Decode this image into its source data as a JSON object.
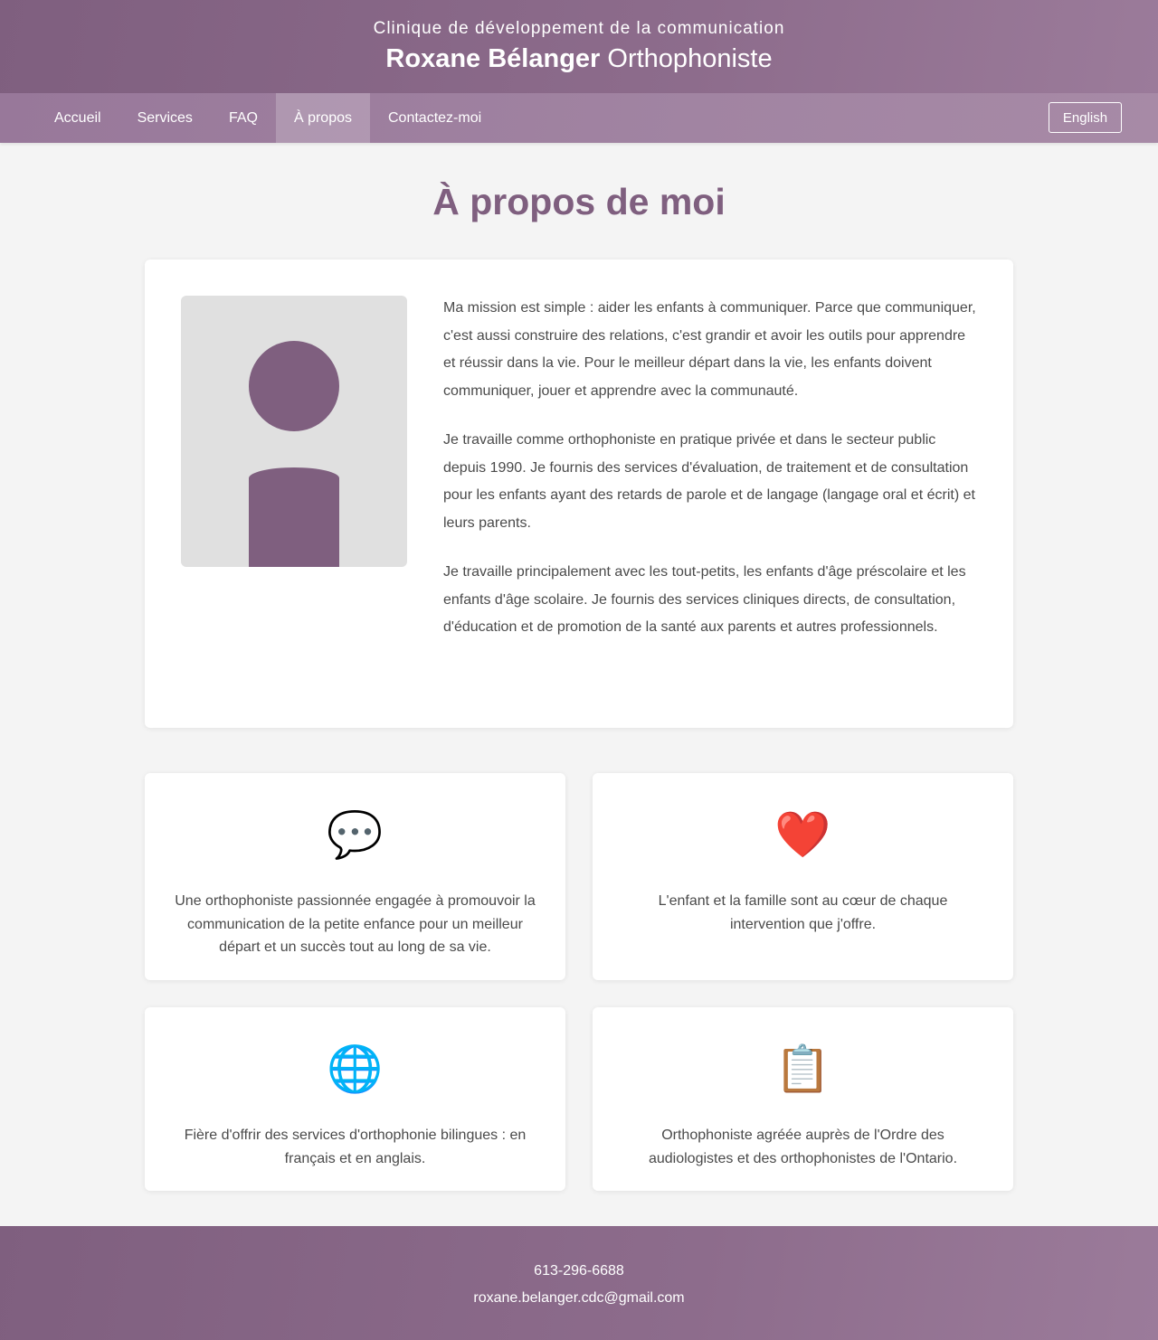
{
  "header": {
    "clinic_name": "Clinique de développement de la communication",
    "name": "Roxane Bélanger",
    "role": "Orthophoniste"
  },
  "nav": {
    "items": [
      {
        "label": "Accueil"
      },
      {
        "label": "Services"
      },
      {
        "label": "FAQ"
      },
      {
        "label": "À propos",
        "active": true
      },
      {
        "label": "Contactez-moi"
      }
    ],
    "language_button": "English"
  },
  "main": {
    "title": "À propos de moi",
    "about_paragraphs": [
      "Ma mission est simple : aider les enfants à communiquer. Parce que communiquer, c'est aussi construire des relations, c'est grandir et avoir les outils pour apprendre et réussir dans la vie. Pour le meilleur départ dans la vie, les enfants doivent communiquer, jouer et apprendre avec la communauté.",
      "Je travaille comme orthophoniste en pratique privée et dans le secteur public depuis 1990. Je fournis des services d'évaluation, de traitement et de consultation pour les enfants ayant des retards de parole et de langage (langage oral et écrit) et leurs parents.",
      "Je travaille principalement avec les tout-petits, les enfants d'âge préscolaire et les enfants d'âge scolaire. Je fournis des services cliniques directs, de consultation, d'éducation et de promotion de la santé aux parents et autres professionnels."
    ],
    "values": [
      {
        "icon": "speech-bubble-icon",
        "glyph": "💬",
        "text": "Une orthophoniste passionnée engagée à promouvoir la communication de la petite enfance pour un meilleur départ et un succès tout au long de sa vie."
      },
      {
        "icon": "heart-icon",
        "glyph": "❤️",
        "text": "L'enfant et la famille sont au cœur de chaque intervention que j'offre."
      },
      {
        "icon": "globe-icon",
        "glyph": "🌐",
        "text": "Fière d'offrir des services d'orthophonie bilingues : en français et en anglais."
      },
      {
        "icon": "clipboard-icon",
        "glyph": "📋",
        "text": "Orthophoniste agréée auprès de l'Ordre des audiologistes et des orthophonistes de l'Ontario."
      }
    ]
  },
  "footer": {
    "phone": "613-296-6688",
    "email": "roxane.belanger.cdc@gmail.com"
  },
  "colors": {
    "brand": "#7f5f7f",
    "nav": "#a184a2",
    "background": "#f4f4f4"
  }
}
